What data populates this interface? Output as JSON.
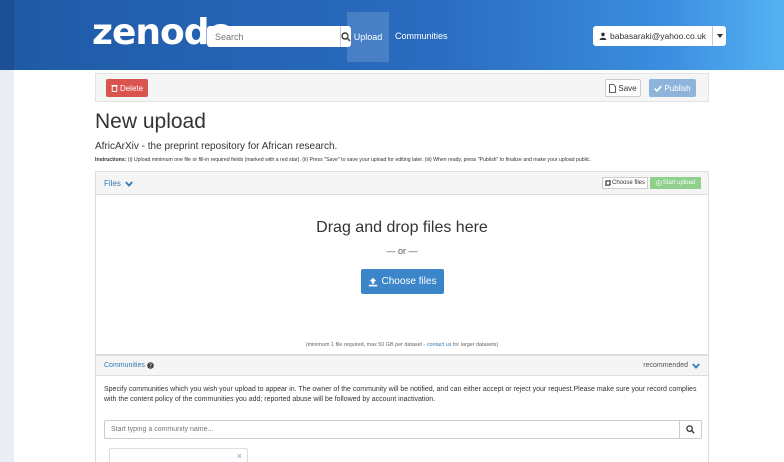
{
  "navbar": {
    "logo": "zenodo",
    "search_placeholder": "Search",
    "nav_upload": "Upload",
    "nav_communities": "Communities",
    "user_email": "babasaraki@yahoo.co.uk"
  },
  "actions": {
    "delete_label": "Delete",
    "save_label": "Save",
    "publish_label": "Publish"
  },
  "page": {
    "title": "New upload",
    "subtitle": "AfricArXiv - the preprint repository for African research.",
    "instructions_label": "Instructions:",
    "instructions_text": " (i) Upload minimum one file or fill-in required fields (marked with a red star). (ii) Press \"Save\" to save your upload for editing later. (iii) When ready, press \"Publish\" to finalize and make your upload public."
  },
  "files": {
    "title": "Files",
    "choose_small_label": "Choose files",
    "start_upload_label": "Start upload",
    "drop_title": "Drag and drop files here",
    "drop_or": "— or —",
    "choose_big_label": "Choose files",
    "note_prefix": "(minimum 1 file required, max 50 GB per dataset - ",
    "note_link": "contact us",
    "note_suffix": " for larger datasets)"
  },
  "communities": {
    "title": "Communities",
    "recommended": "recommended",
    "description": "Specify communities which you wish your upload to appear in. The owner of the community will be notified, and can either accept or reject your request.Please make sure your record complies with the content policy of the communities you add; reported abuse will be followed by account inactivation.",
    "search_placeholder": "Start typing a community name...",
    "chip_close": "×"
  },
  "colors": {
    "navbar": "#2a6cc0",
    "delete": "#d9534f",
    "publish": "#8eb4dc",
    "choose_files": "#3a86c9",
    "start_upload": "#8fd08f",
    "link": "#337ab7"
  }
}
